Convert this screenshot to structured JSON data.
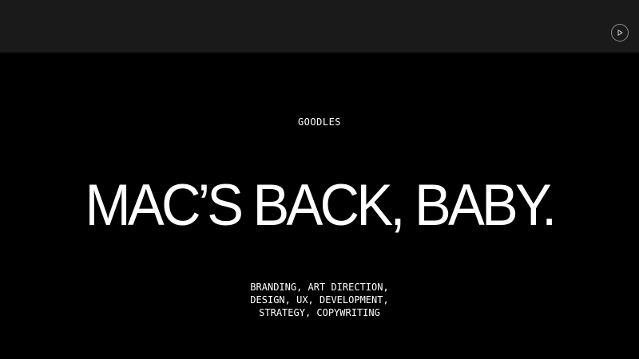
{
  "header": {
    "play_icon": "play-circle-icon"
  },
  "hero": {
    "client": "GOODLES",
    "headline": "MAC’S BACK, BABY.",
    "services": [
      "BRANDING, ART DIRECTION,",
      "DESIGN, UX, DEVELOPMENT,",
      "STRATEGY, COPYWRITING"
    ]
  },
  "colors": {
    "background": "#000000",
    "top_bar": "#1a1a1a",
    "text": "#ffffff"
  }
}
